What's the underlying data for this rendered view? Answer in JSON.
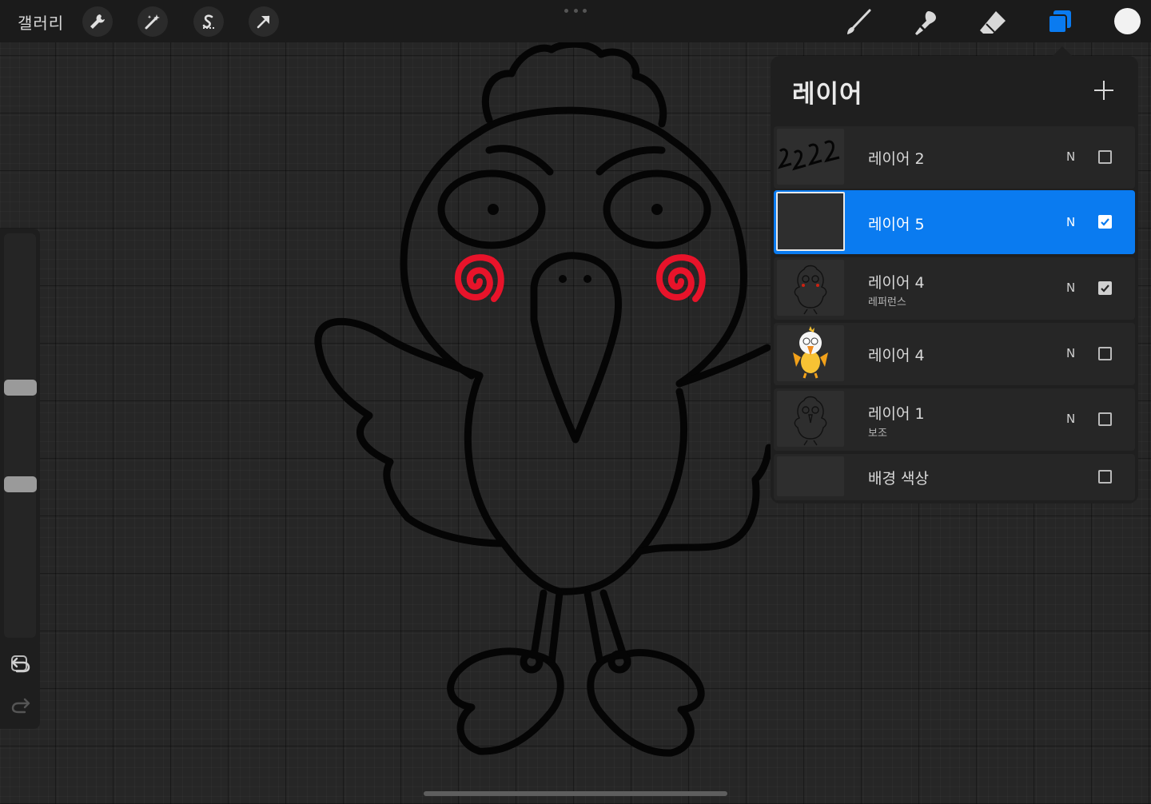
{
  "toolbar": {
    "gallery_label": "갤러리",
    "left_tools": [
      "wrench-icon",
      "magic-wand-icon",
      "selection-s-icon",
      "transform-arrow-icon"
    ],
    "right_tools": [
      "brush-icon",
      "smudge-icon",
      "eraser-icon",
      "layers-icon"
    ],
    "active_tool": "layers-icon",
    "accent_color": "#0a7bf0",
    "current_color": "#f2f2f2"
  },
  "layers_panel": {
    "title": "레이어",
    "layers": [
      {
        "name": "레이어 2",
        "sub": "",
        "blend": "N",
        "visible": false,
        "selected": false
      },
      {
        "name": "레이어 5",
        "sub": "",
        "blend": "N",
        "visible": true,
        "selected": true
      },
      {
        "name": "레이어 4",
        "sub": "레퍼런스",
        "blend": "N",
        "visible": true,
        "selected": false
      },
      {
        "name": "레이어 4",
        "sub": "",
        "blend": "N",
        "visible": false,
        "selected": false
      },
      {
        "name": "레이어 1",
        "sub": "보조",
        "blend": "N",
        "visible": false,
        "selected": false
      },
      {
        "name": "배경 색상",
        "sub": "",
        "blend": "",
        "visible": false,
        "selected": false
      }
    ]
  },
  "sidebar": {
    "brush_size": 0.52,
    "opacity": 0.7
  },
  "drawing": {
    "line_color": "#050505",
    "cheek_color": "#e8132a"
  }
}
